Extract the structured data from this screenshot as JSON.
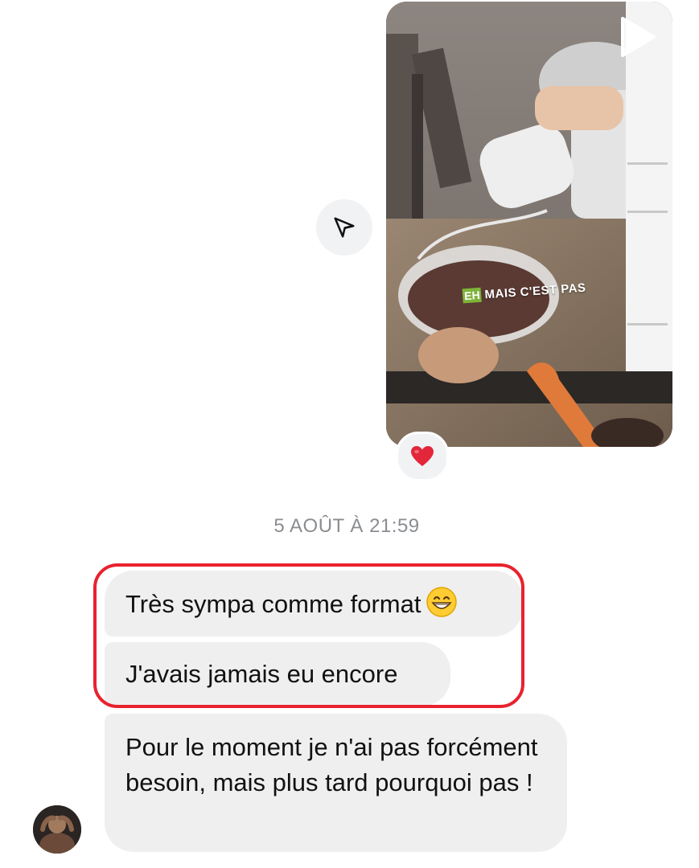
{
  "shared_post": {
    "type": "video",
    "caption_tag": "EH",
    "caption_text": "MAIS C'EST PAS",
    "reaction": "❤️"
  },
  "timestamp": "5 AOÛT À 21:59",
  "messages": [
    {
      "text": "Très sympa comme format",
      "emoji": "grinning-face"
    },
    {
      "text": "J'avais jamais eu encore"
    },
    {
      "text": "Pour le moment je n'ai pas forcément besoin, mais plus tard pourquoi pas !"
    }
  ],
  "colors": {
    "bubble_bg": "#efefef",
    "timestamp": "#8a8d91",
    "highlight_outline": "#e8222e",
    "reaction_heart": "#e3263a"
  }
}
